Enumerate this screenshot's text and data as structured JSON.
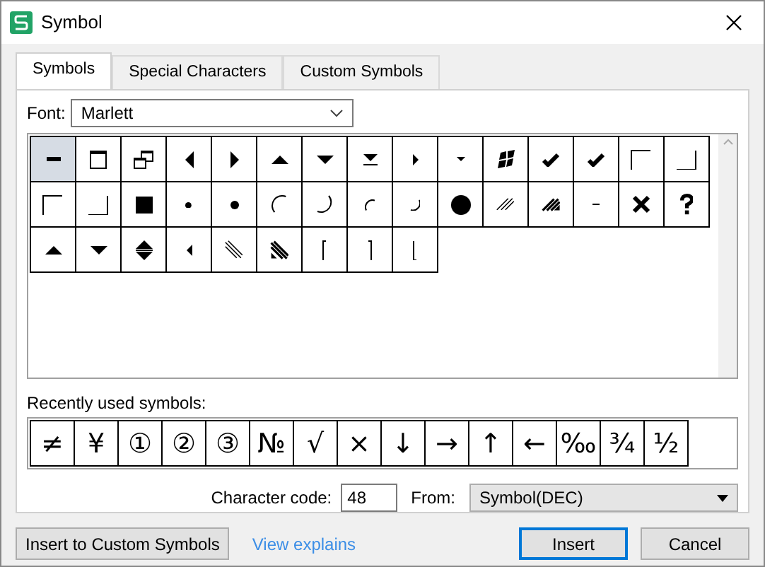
{
  "window": {
    "title": "Symbol"
  },
  "tabs": [
    {
      "label": "Symbols",
      "selected": true
    },
    {
      "label": "Special Characters",
      "selected": false
    },
    {
      "label": "Custom Symbols",
      "selected": false
    }
  ],
  "font": {
    "label": "Font:",
    "value": "Marlett"
  },
  "symbols": [
    {
      "kind": "minimize",
      "selected": true
    },
    {
      "kind": "maximize",
      "selected": false
    },
    {
      "kind": "restore",
      "selected": false
    },
    {
      "kind": "tri-left",
      "selected": false
    },
    {
      "kind": "tri-right",
      "selected": false
    },
    {
      "kind": "tri-up",
      "selected": false
    },
    {
      "kind": "tri-down",
      "selected": false
    },
    {
      "kind": "eject",
      "selected": false
    },
    {
      "kind": "small-tri-right",
      "selected": false
    },
    {
      "kind": "small-tri-down",
      "selected": false
    },
    {
      "kind": "flag",
      "selected": false
    },
    {
      "kind": "check",
      "selected": false
    },
    {
      "kind": "check",
      "selected": false
    },
    {
      "kind": "corner-tl",
      "selected": false
    },
    {
      "kind": "corner-br",
      "selected": false
    },
    {
      "kind": "corner-tl",
      "selected": false
    },
    {
      "kind": "corner-br",
      "selected": false
    },
    {
      "kind": "square",
      "selected": false
    },
    {
      "kind": "dot-small",
      "selected": false
    },
    {
      "kind": "dot",
      "selected": false
    },
    {
      "kind": "arc-tl",
      "selected": false
    },
    {
      "kind": "arc-br",
      "selected": false
    },
    {
      "kind": "arc-tl-small",
      "selected": false
    },
    {
      "kind": "arc-br-small",
      "selected": false
    },
    {
      "kind": "disc",
      "selected": false
    },
    {
      "kind": "hatch-light",
      "selected": false
    },
    {
      "kind": "hatch-heavy",
      "selected": false
    },
    {
      "kind": "dash",
      "selected": false
    },
    {
      "kind": "cross",
      "selected": false
    },
    {
      "kind": "question",
      "selected": false
    },
    {
      "kind": "tri-up",
      "selected": false
    },
    {
      "kind": "tri-down",
      "selected": false
    },
    {
      "kind": "up-down",
      "selected": false
    },
    {
      "kind": "small-tri-left",
      "selected": false
    },
    {
      "kind": "hatch-light-se",
      "selected": false
    },
    {
      "kind": "hatch-heavy-se",
      "selected": false
    },
    {
      "kind": "bar-tl",
      "selected": false
    },
    {
      "kind": "bar-tr",
      "selected": false
    },
    {
      "kind": "bar-bl",
      "selected": false
    }
  ],
  "recent": {
    "label": "Recently used symbols:",
    "symbols": [
      "≠",
      "¥",
      "①",
      "②",
      "③",
      "№",
      "√",
      "×",
      "↓",
      "→",
      "↑",
      "←",
      "‰",
      "¾",
      "½"
    ]
  },
  "character_code": {
    "label": "Character code:",
    "value": "48"
  },
  "from": {
    "label": "From:",
    "value": "Symbol(DEC)"
  },
  "buttons": {
    "insert_custom": "Insert to Custom Symbols",
    "link": "View explains",
    "insert": "Insert",
    "cancel": "Cancel"
  }
}
